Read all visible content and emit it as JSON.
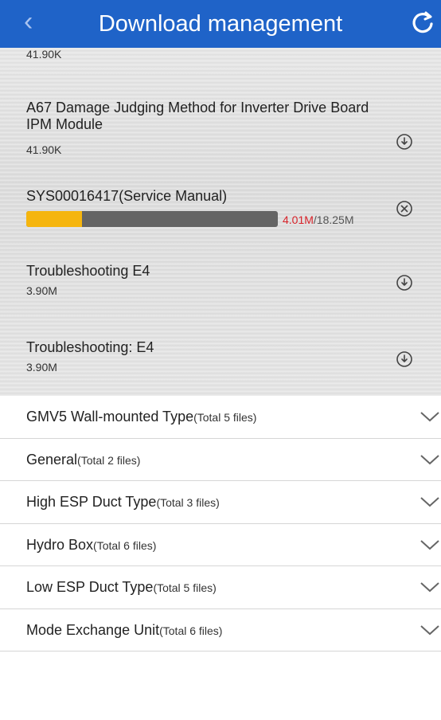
{
  "header": {
    "back_icon": "back-chevron-icon",
    "title": "Download management",
    "refresh_icon": "refresh-icon"
  },
  "downloads": {
    "partial_size": "41.90K",
    "items": [
      {
        "name": "A67 Damage Judging Method for Inverter Drive Board IPM Module",
        "size": "41.90K",
        "icon": "download-icon"
      },
      {
        "name": "SYS00016417(Service Manual)",
        "progress_done": "4.01M",
        "progress_total": "/18.25M",
        "progress_fraction": 0.22,
        "icon": "cancel-icon"
      },
      {
        "name": "Troubleshooting E4",
        "size": "3.90M",
        "icon": "download-icon"
      },
      {
        "name": "Troubleshooting: E4",
        "size": "3.90M",
        "icon": "download-icon"
      }
    ]
  },
  "groups": [
    {
      "name": "GMV5 Wall-mounted Type",
      "count": "(Total 5 files)"
    },
    {
      "name": "General",
      "count": "(Total 2 files)"
    },
    {
      "name": "High ESP Duct Type",
      "count": "(Total 3 files)"
    },
    {
      "name": "Hydro Box",
      "count": "(Total 6 files)"
    },
    {
      "name": "Low ESP Duct Type",
      "count": "(Total 5 files)"
    },
    {
      "name": "Mode Exchange Unit",
      "count": "(Total 6 files)"
    }
  ],
  "colors": {
    "header_bg": "#1f63c8",
    "progress_fill": "#f5b50e",
    "progress_track": "#646464",
    "progress_done_text": "#d8232a"
  }
}
